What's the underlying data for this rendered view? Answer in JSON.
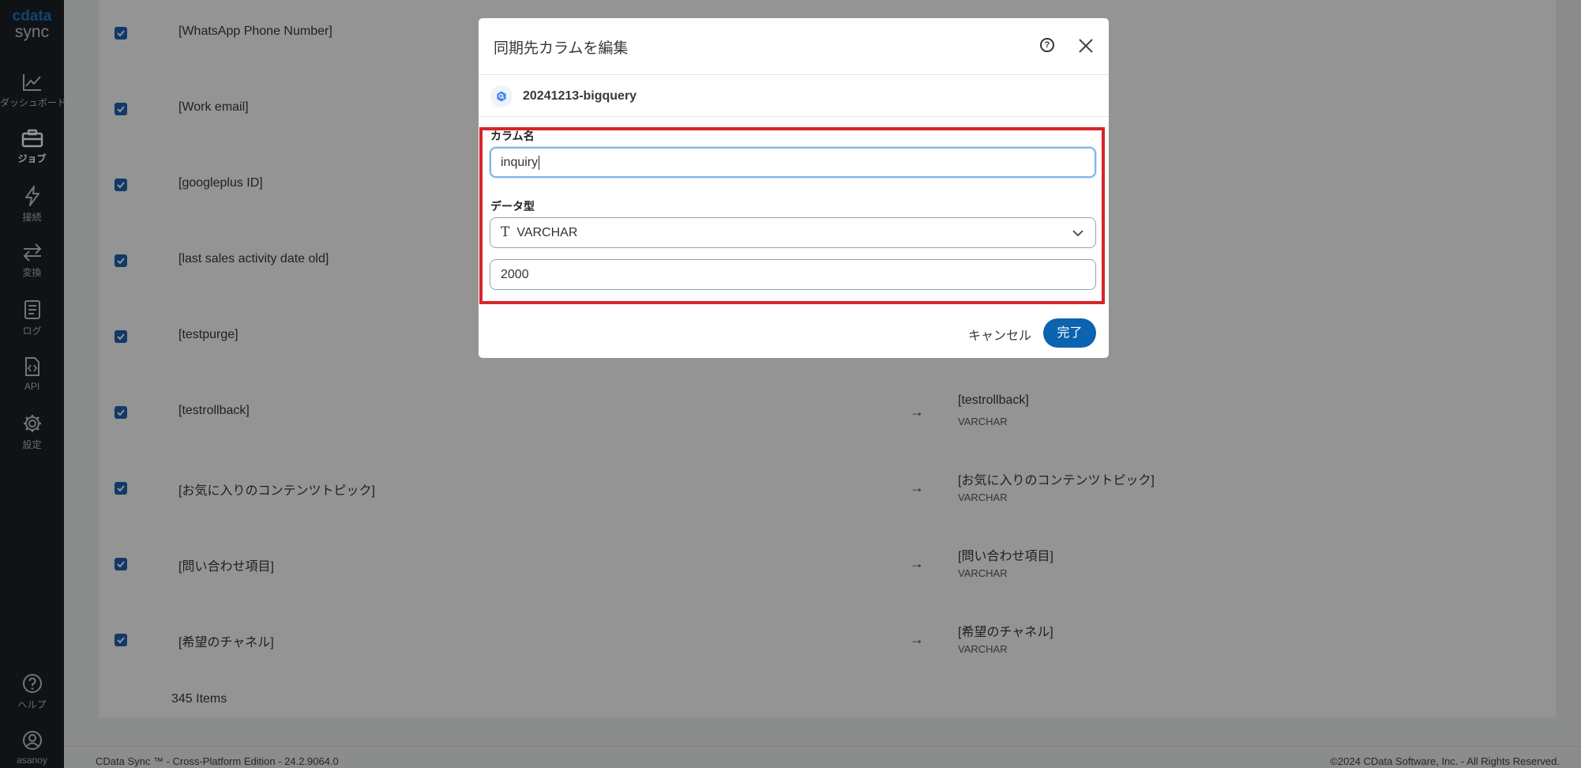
{
  "brand": {
    "logo_top": "cdata",
    "logo_bottom": "sync"
  },
  "sidebar": {
    "items": [
      {
        "label": "ダッシュボード",
        "icon": "chart-line-icon"
      },
      {
        "label": "ジョブ",
        "icon": "briefcase-icon",
        "active": true
      },
      {
        "label": "接続",
        "icon": "bolt-icon"
      },
      {
        "label": "変換",
        "icon": "transfer-arrows-icon"
      },
      {
        "label": "ログ",
        "icon": "notebook-icon"
      },
      {
        "label": "API",
        "icon": "code-file-icon"
      },
      {
        "label": "設定",
        "icon": "gear-icon"
      }
    ],
    "bottom_items": [
      {
        "label": "ヘルプ",
        "icon": "help-circle-icon"
      },
      {
        "label": "asanoy",
        "icon": "user-avatar-icon"
      }
    ]
  },
  "table": {
    "rows": [
      {
        "source": "[WhatsApp Phone Number]",
        "dest": "",
        "dtype": ""
      },
      {
        "source": "[Work email]",
        "dest": "",
        "dtype": ""
      },
      {
        "source": "[googleplus ID]",
        "dest": "",
        "dtype": ""
      },
      {
        "source": "[last sales activity date old]",
        "dest": "",
        "dtype": ""
      },
      {
        "source": "[testpurge]",
        "dest": "",
        "dtype": ""
      },
      {
        "source": "[testrollback]",
        "dest": "[testrollback]",
        "dtype": "VARCHAR"
      },
      {
        "source": "[お気に入りのコンテンツトピック]",
        "dest": "[お気に入りのコンテンツトピック]",
        "dtype": "VARCHAR"
      },
      {
        "source": "[問い合わせ項目]",
        "dest": "[問い合わせ項目]",
        "dtype": "VARCHAR"
      },
      {
        "source": "[希望のチャネル]",
        "dest": "[希望のチャネル]",
        "dtype": "VARCHAR"
      }
    ],
    "arrow": "→",
    "items_count": "345 Items"
  },
  "footer": {
    "left": "CData Sync ™ - Cross-Platform Edition - 24.2.9064.0",
    "right": "©2024 CData Software, Inc. - All Rights Reserved."
  },
  "modal": {
    "title": "同期先カラムを編集",
    "connection_name": "20241213-bigquery",
    "column_name_label": "カラム名",
    "column_name_value": "inquiry",
    "data_type_label": "データ型",
    "data_type_value": "VARCHAR",
    "data_type_icon": "T",
    "length_value": "2000",
    "cancel_label": "キャンセル",
    "done_label": "完了",
    "help_icon_glyph": "?",
    "highlight_color": "#d8232c",
    "accent_color": "#0c63b0"
  }
}
